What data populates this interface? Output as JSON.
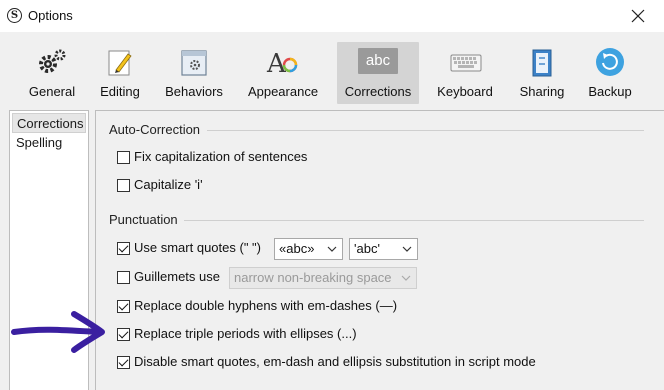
{
  "window": {
    "title": "Options",
    "app_icon_glyph": "S"
  },
  "toolbar": {
    "items": [
      {
        "label": "General",
        "icon": "gears-icon"
      },
      {
        "label": "Editing",
        "icon": "pencil-note-icon"
      },
      {
        "label": "Behaviors",
        "icon": "window-gear-icon"
      },
      {
        "label": "Appearance",
        "icon": "font-color-icon"
      },
      {
        "label": "Corrections",
        "icon": "abc-icon",
        "icon_text": "abc",
        "selected": true
      },
      {
        "label": "Keyboard",
        "icon": "keyboard-icon"
      },
      {
        "label": "Sharing",
        "icon": "sharing-book-icon"
      },
      {
        "label": "Backup",
        "icon": "backup-sync-icon"
      }
    ]
  },
  "sidebar": {
    "items": [
      {
        "label": "Corrections",
        "selected": true
      },
      {
        "label": "Spelling",
        "selected": false
      }
    ]
  },
  "auto_correction": {
    "header": "Auto-Correction",
    "options": [
      {
        "label": "Fix capitalization of sentences",
        "checked": false
      },
      {
        "label": "Capitalize 'i'",
        "checked": false
      }
    ]
  },
  "punctuation": {
    "header": "Punctuation",
    "smart_quotes": {
      "label": "Use smart quotes (\" \")",
      "checked": true,
      "double_select": "«abc»",
      "single_select": "'abc'"
    },
    "guillemets": {
      "label": "Guillemets use",
      "checked": false,
      "select": "narrow non-breaking space",
      "disabled": true
    },
    "options": [
      {
        "label": "Replace double hyphens with em-dashes (—)",
        "checked": true
      },
      {
        "label": "Replace triple periods with ellipses (...)",
        "checked": true
      },
      {
        "label": "Disable smart quotes, em-dash and ellipsis substitution in script mode",
        "checked": true
      }
    ]
  },
  "colors": {
    "annotation_arrow": "#3a1fa0",
    "selected_tab_bg": "#d4d4d4",
    "panel_bg": "#f0f0f0"
  }
}
